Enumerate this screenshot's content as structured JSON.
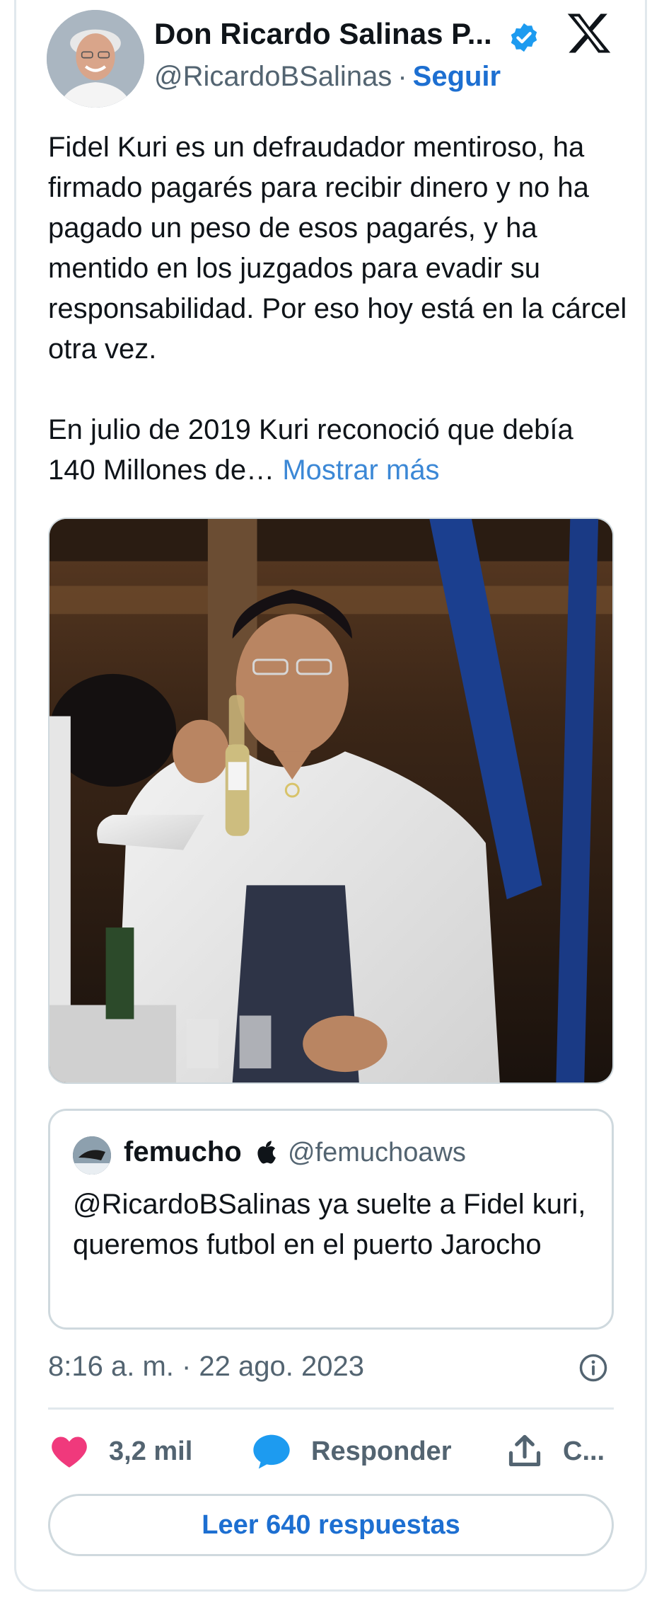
{
  "author": {
    "display_name": "Don Ricardo Salinas P...",
    "handle": "@RicardoBSalinas",
    "separator": "·",
    "follow_label": "Seguir"
  },
  "tweet": {
    "text_part1": "Fidel Kuri es un defraudador mentiroso, ha firmado pagarés para recibir dinero y no ha pagado un peso de esos pagarés, y ha mentido en los juzgados para evadir su responsabilidad. Por eso hoy está en la cárcel otra vez.",
    "text_part2": "En julio de 2019 Kuri reconoció que debía 140 Millones de…",
    "more_label": "Mostrar más"
  },
  "quoted": {
    "name": "femucho",
    "handle": "@femuchoaws",
    "text": "@RicardoBSalinas ya suelte a Fidel kuri, queremos futbol en el puerto Jarocho"
  },
  "meta": {
    "timestamp": "8:16 a. m. · 22 ago. 2023"
  },
  "actions": {
    "likes": "3,2 mil",
    "reply_label": "Responder",
    "share_label": "C..."
  },
  "read_replies_label": "Leer 640 respuestas",
  "colors": {
    "accent": "#1d6fd1",
    "link": "#3c88d6",
    "like": "#f0397c",
    "reply": "#1d9bf0",
    "muted": "#536471"
  },
  "icons": [
    "verified-badge-icon",
    "x-logo-icon",
    "apple-icon",
    "info-icon",
    "heart-icon",
    "speech-bubble-icon",
    "share-icon"
  ]
}
